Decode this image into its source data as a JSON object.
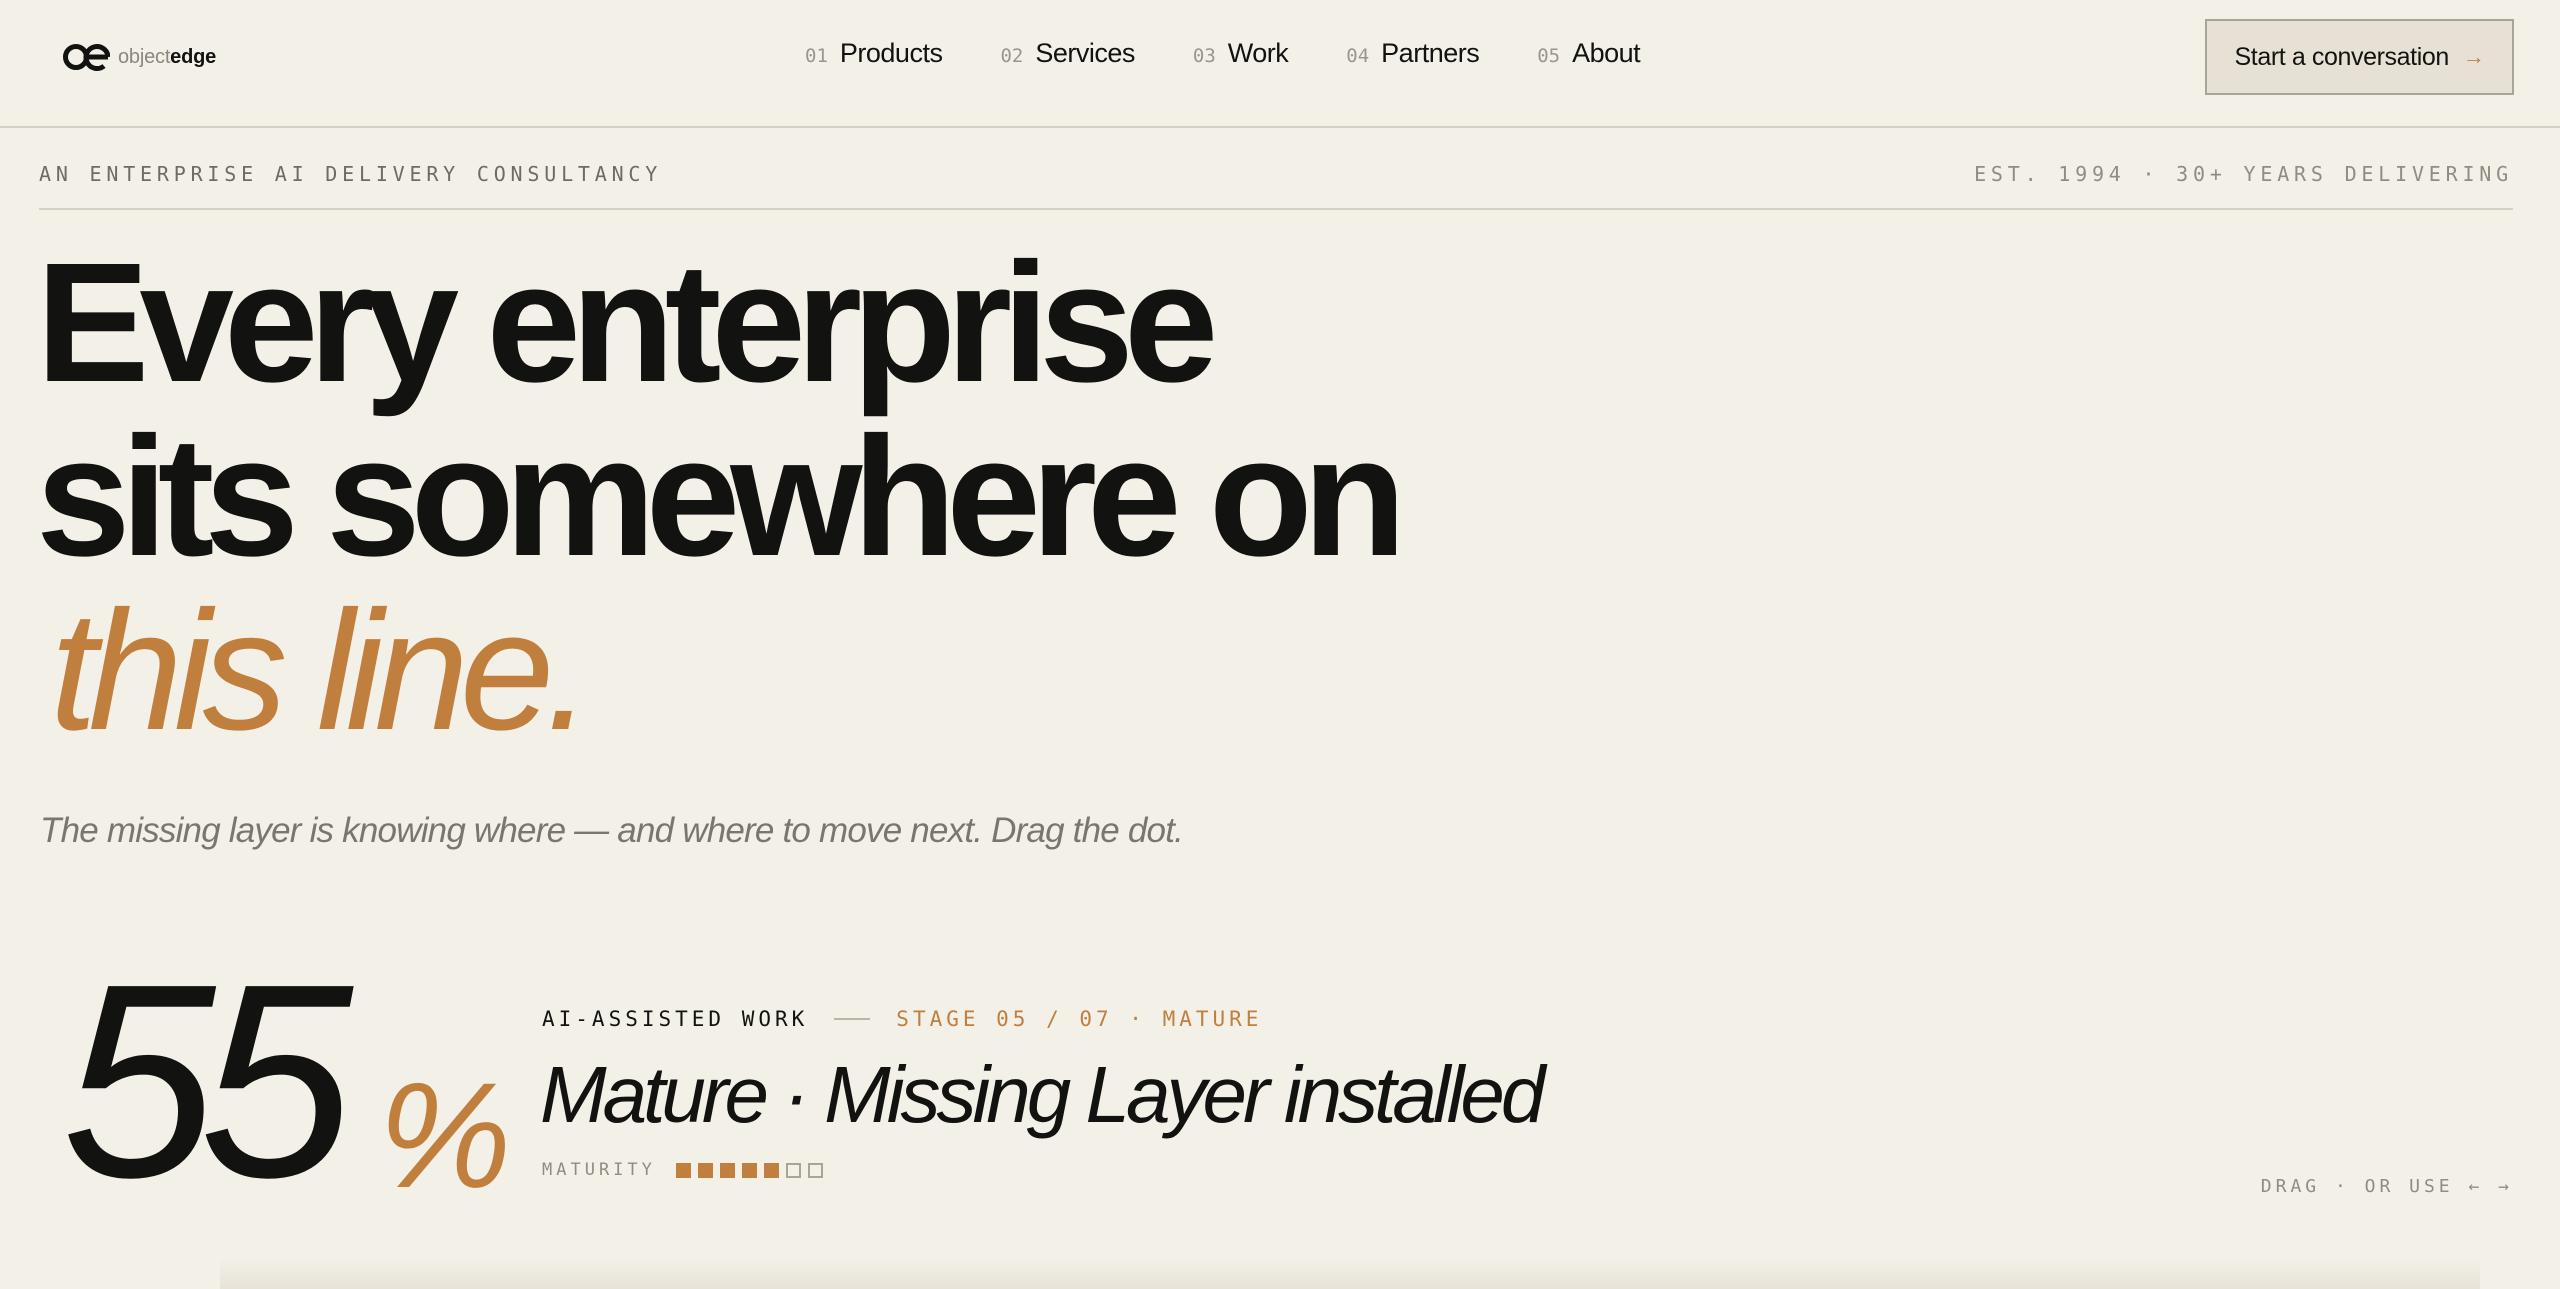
{
  "brand": {
    "name_light": "object",
    "name_bold": "edge",
    "logo_icon": "oe-monogram-icon"
  },
  "nav": {
    "items": [
      {
        "num": "01",
        "label": "Products"
      },
      {
        "num": "02",
        "label": "Services"
      },
      {
        "num": "03",
        "label": "Work"
      },
      {
        "num": "04",
        "label": "Partners"
      },
      {
        "num": "05",
        "label": "About"
      }
    ],
    "cta_label": "Start a conversation",
    "cta_arrow": "→"
  },
  "subbar": {
    "left": "An Enterprise AI Delivery Consultancy",
    "right": "EST. 1994 · 30+ YEARS DELIVERING"
  },
  "hero": {
    "line1": "Every enterprise",
    "line2": "sits somewhere on",
    "accent": "this line.",
    "lede": "The missing layer is knowing where — and where to move next. Drag the dot."
  },
  "stat": {
    "value": "55",
    "unit": "%",
    "track": "AI-Assisted Work",
    "stage_info": "Stage 05 / 07 · Mature",
    "title": "Mature · Missing Layer installed",
    "maturity_label": "MATURITY",
    "maturity_level": 5,
    "maturity_total": 7,
    "hint": "DRAG · OR USE ← →"
  },
  "colors": {
    "background": "#f3f0e8",
    "ink": "#121210",
    "accent": "#c17f3e",
    "muted": "#908c83"
  }
}
